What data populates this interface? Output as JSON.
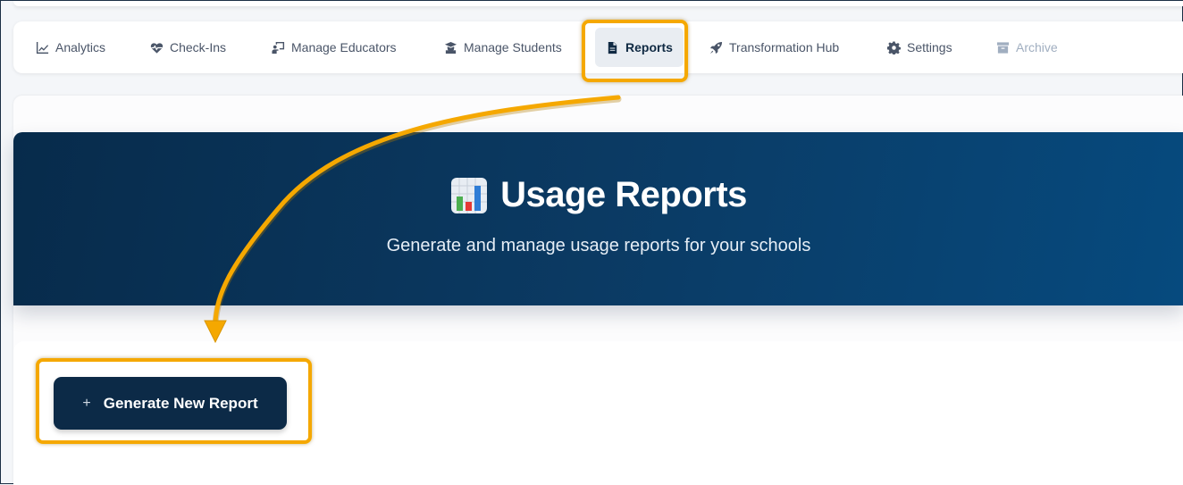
{
  "nav": {
    "tabs": [
      {
        "label": "Analytics",
        "icon": "chart-line-icon"
      },
      {
        "label": "Check-Ins",
        "icon": "heart-pulse-icon"
      },
      {
        "label": "Manage Educators",
        "icon": "chalkboard-teacher-icon"
      },
      {
        "label": "Manage Students",
        "icon": "graduate-icon"
      },
      {
        "label": "Reports",
        "icon": "document-icon",
        "active": true
      },
      {
        "label": "Transformation Hub",
        "icon": "rocket-icon"
      },
      {
        "label": "Settings",
        "icon": "gear-icon"
      },
      {
        "label": "Archive",
        "icon": "archive-box-icon",
        "disabled": true
      }
    ]
  },
  "hero": {
    "icon": "bar-chart-emoji-icon",
    "title": "Usage Reports",
    "subtitle": "Generate and manage usage reports for your schools"
  },
  "actions": {
    "generate_icon": "+",
    "generate_label": "Generate New Report"
  },
  "colors": {
    "highlight": "#f5a800",
    "hero_start": "#072b4b",
    "hero_end": "#064a7e",
    "button": "#0c2a47"
  }
}
